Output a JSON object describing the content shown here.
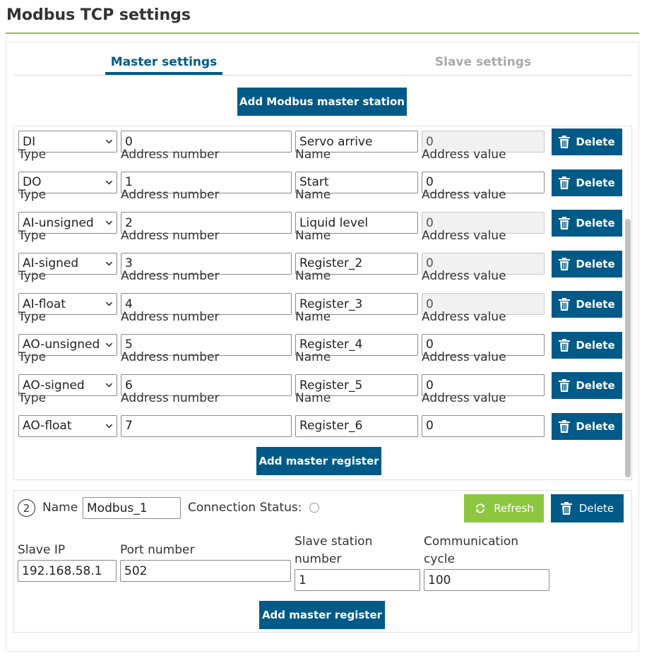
{
  "page": {
    "title": "Modbus TCP settings"
  },
  "tabs": {
    "master": "Master settings",
    "slave": "Slave settings"
  },
  "buttons": {
    "add_station": "Add Modbus master station",
    "add_register": "Add master register",
    "delete": "Delete",
    "refresh": "Refresh"
  },
  "station1": {
    "labels": {
      "type": "Type",
      "address_number": "Address number",
      "name": "Name",
      "address_value": "Address value"
    },
    "registers": [
      {
        "type": "DI",
        "address": "0",
        "name": "Servo arrive",
        "value": "0",
        "value_readonly": true
      },
      {
        "type": "DO",
        "address": "1",
        "name": "Start",
        "value": "0",
        "value_readonly": false
      },
      {
        "type": "AI-unsigned",
        "address": "2",
        "name": "Liquid level",
        "value": "0",
        "value_readonly": true
      },
      {
        "type": "AI-signed",
        "address": "3",
        "name": "Register_2",
        "value": "0",
        "value_readonly": true
      },
      {
        "type": "AI-float",
        "address": "4",
        "name": "Register_3",
        "value": "0",
        "value_readonly": true
      },
      {
        "type": "AO-unsigned",
        "address": "5",
        "name": "Register_4",
        "value": "0",
        "value_readonly": false
      },
      {
        "type": "AO-signed",
        "address": "6",
        "name": "Register_5",
        "value": "0",
        "value_readonly": false
      },
      {
        "type": "AO-float",
        "address": "7",
        "name": "Register_6",
        "value": "0",
        "value_readonly": false
      }
    ]
  },
  "station2": {
    "number": "2",
    "name_label": "Name",
    "name_value": "Modbus_1",
    "connection_status_label": "Connection Status:",
    "slave_ip_label": "Slave IP",
    "slave_ip_value": "192.168.58.1",
    "port_label": "Port number",
    "port_value": "502",
    "slave_station_label_1": "Slave station",
    "slave_station_label_2": "number",
    "slave_station_value": "1",
    "comm_cycle_label_1": "Communication",
    "comm_cycle_label_2": "cycle",
    "comm_cycle_value": "100"
  },
  "icons": {
    "delete": "trash-icon",
    "refresh": "refresh-icon",
    "select": "chevron-down-icon",
    "status": "status-circle-icon"
  },
  "colors": {
    "primary": "#005a87",
    "accent_green": "#8dc63f",
    "inactive_tab": "#aaaaaa"
  }
}
